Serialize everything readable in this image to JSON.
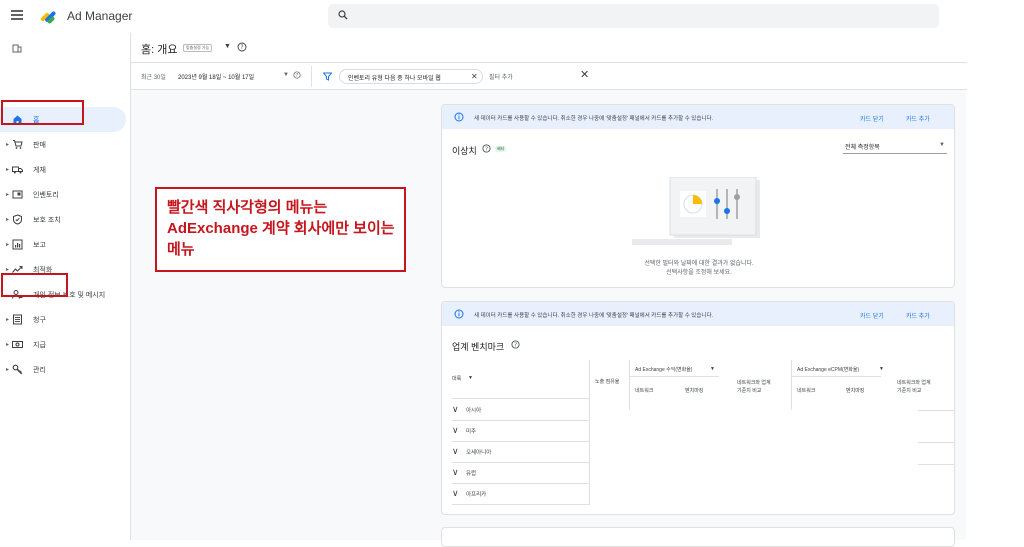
{
  "app": {
    "name": "Ad Manager",
    "search_placeholder": ""
  },
  "page": {
    "title": "홈: 개요",
    "title_badge": "맞춤설정 가능"
  },
  "filters": {
    "date_prefix": "최근 30일",
    "date_range": "2023년 9월 18일 ~ 10월 17일",
    "chip_label": "인벤토리 유형 다음 중 하나 모바일 웹",
    "add_filter": "필터 추가"
  },
  "sidebar": {
    "items": [
      {
        "label": "홈",
        "icon": "home-icon",
        "active": true
      },
      {
        "label": "판매",
        "icon": "cart-icon"
      },
      {
        "label": "게재",
        "icon": "truck-icon"
      },
      {
        "label": "인벤토리",
        "icon": "inventory-icon"
      },
      {
        "label": "보호 조치",
        "icon": "shield-icon"
      },
      {
        "label": "보고",
        "icon": "report-icon"
      },
      {
        "label": "최적화",
        "icon": "trend-icon"
      },
      {
        "label": "개인 정보 보호 및 메시지",
        "icon": "privacy-icon"
      },
      {
        "label": "청구",
        "icon": "billing-icon"
      },
      {
        "label": "지급",
        "icon": "payment-icon"
      },
      {
        "label": "관리",
        "icon": "admin-icon"
      }
    ]
  },
  "banner": {
    "text": "새 데이터 카드를 사용할 수 있습니다. 취소한 경우 나중에 '맞춤설정' 패널에서 카드를 추가할 수 있습니다.",
    "close_label": "카드 닫기",
    "add_label": "카드 추가"
  },
  "anomaly_card": {
    "title": "이상치",
    "beta": "베타",
    "select_value": "전체 측정항목",
    "empty_line1": "선택한 필터와 날짜에 대한 결과가 없습니다.",
    "empty_line2": "선택사항을 조정해 보세요."
  },
  "benchmark_card": {
    "title": "업계 벤치마크",
    "col_region": "대륙",
    "col_impressions": "노출 점유율",
    "group1": "Ad Exchange 수익(변화율)",
    "group2": "Ad Exchange eCPM(변화율)",
    "sub_network": "네트워크",
    "sub_benchmark": "벤치마킹",
    "sub_compare_l1": "네트워크와 업계",
    "sub_compare_l2": "기준치 비교",
    "regions": [
      "아시아",
      "미주",
      "오세아니아",
      "유럽",
      "아프리카"
    ]
  },
  "annotation": {
    "text": "빨간색 직사각형의 메뉴는 AdExchange 계약 회사에만 보이는 메뉴"
  },
  "colors": {
    "accent": "#1a73e8",
    "annotation_red": "#c5161d",
    "active_nav_bg": "#e8f0fe"
  }
}
